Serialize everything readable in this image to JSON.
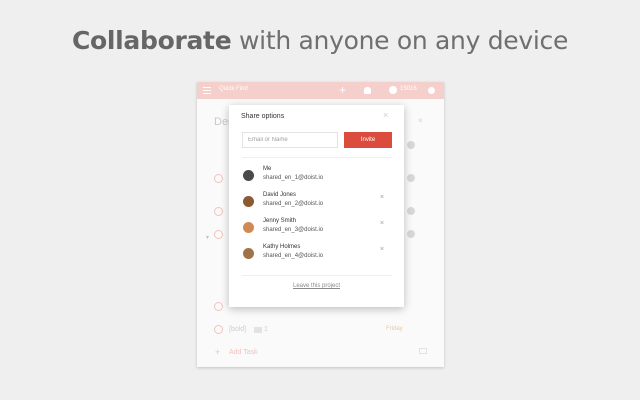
{
  "headline": {
    "bold": "Collaborate",
    "rest": " with anyone on any device"
  },
  "app": {
    "quick_find": "Quick Find",
    "add_symbol": "+",
    "karma": "15016",
    "project_title": "Des",
    "bg_close": "×",
    "task_label": "[bold]",
    "task_comment_count": "1",
    "task_due": "Friday",
    "add_task_symbol": "+",
    "add_task": "Add Task",
    "chevron": "▾"
  },
  "share_dialog": {
    "title": "Share options",
    "close": "×",
    "email_placeholder": "Email or Name",
    "invite_label": "Invite",
    "members": [
      {
        "name": "Me",
        "email": "shared_en_1@doist.io",
        "removable": false,
        "avatar_color": "#4a4a4a"
      },
      {
        "name": "David Jones",
        "email": "shared_en_2@doist.io",
        "removable": true,
        "avatar_color": "#8a5a32"
      },
      {
        "name": "Jenny Smith",
        "email": "shared_en_3@doist.io",
        "removable": true,
        "avatar_color": "#d28a55"
      },
      {
        "name": "Kathy Holmes",
        "email": "shared_en_4@doist.io",
        "removable": true,
        "avatar_color": "#a0724a"
      }
    ],
    "remove_symbol": "×",
    "leave_label": "Leave this project"
  },
  "colors": {
    "accent": "#db4c3f",
    "topbar": "#f5cfcb",
    "background": "#efefef"
  }
}
